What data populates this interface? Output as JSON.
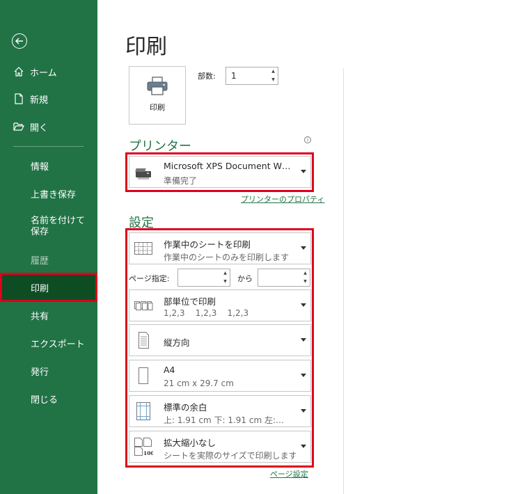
{
  "sidebar": {
    "back_label": "戻る",
    "home": "ホーム",
    "new": "新規",
    "open": "開く",
    "info": "情報",
    "save": "上書き保存",
    "save_as": "名前を付けて保存",
    "history": "履歴",
    "print": "印刷",
    "share": "共有",
    "export": "エクスポート",
    "publish": "発行",
    "close": "閉じる"
  },
  "main": {
    "title": "印刷",
    "print_button": "印刷",
    "copies_label": "部数:",
    "copies_value": "1",
    "printer_section": "プリンター",
    "printer": {
      "name": "Microsoft XPS Document W…",
      "status": "準備完了",
      "properties_link": "プリンターのプロパティ"
    },
    "settings_section": "設定",
    "settings": {
      "what": {
        "title": "作業中のシートを印刷",
        "desc": "作業中のシートのみを印刷します"
      },
      "pages_label": "ページ指定:",
      "pages_from": "",
      "pages_to_label": "から",
      "pages_to": "",
      "collate": {
        "title": "部単位で印刷",
        "desc": "1,2,3    1,2,3    1,2,3"
      },
      "orientation": {
        "title": "縦方向"
      },
      "paper": {
        "title": "A4",
        "desc": "21 cm x 29.7 cm"
      },
      "margins": {
        "title": "標準の余白",
        "desc": "上: 1.91 cm 下: 1.91 cm 左:…"
      },
      "scaling": {
        "title": "拡大縮小なし",
        "desc": "シートを実際のサイズで印刷します"
      }
    },
    "page_setup_link": "ページ設定"
  },
  "colors": {
    "sidebar_bg": "#217346",
    "sidebar_active": "#0e4d24",
    "accent_green": "#217346",
    "highlight_red": "#e0001b"
  }
}
